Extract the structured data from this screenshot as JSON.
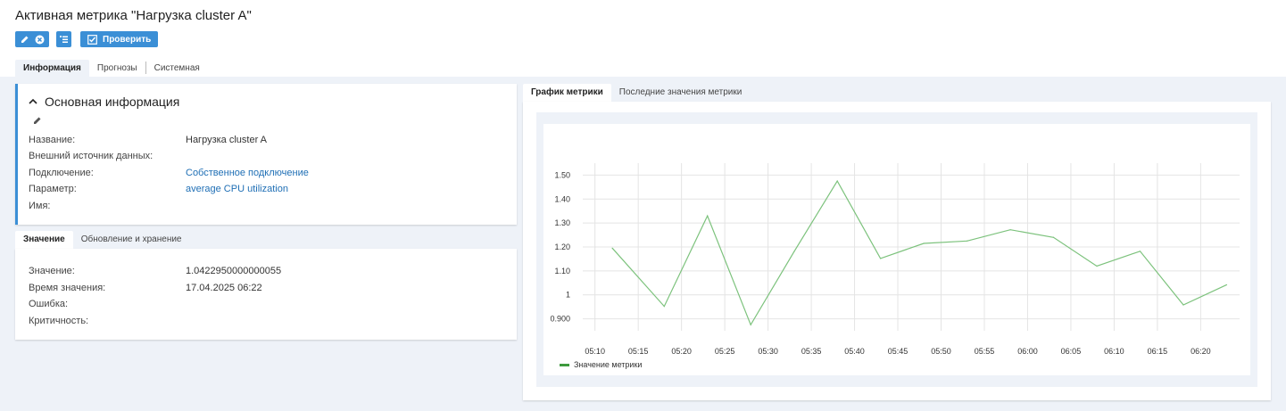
{
  "page": {
    "title": "Активная метрика \"Нагрузка cluster A\""
  },
  "toolbar": {
    "edit_icon": "pencil-icon",
    "delete_icon": "close-circle-icon",
    "add_icon": "add-list-icon",
    "check_label": "Проверить",
    "check_icon": "checkbox-icon"
  },
  "tabs_top": [
    {
      "label": "Информация",
      "active": true
    },
    {
      "label": "Прогнозы",
      "active": false
    },
    {
      "label": "Системная",
      "active": false
    }
  ],
  "basic_info": {
    "header": "Основная информация",
    "collapse_icon": "chevron-up-icon",
    "edit_icon": "pencil-icon",
    "fields": [
      {
        "label": "Название:",
        "value": "Нагрузка cluster A",
        "link": false
      },
      {
        "label": "Внешний источник данных:",
        "value": "",
        "link": false
      },
      {
        "label": "Подключение:",
        "value": "Собственное подключение",
        "link": true
      },
      {
        "label": "Параметр:",
        "value": "average CPU utilization",
        "link": true
      },
      {
        "label": "Имя:",
        "value": "",
        "link": false
      }
    ]
  },
  "tabs_mid": [
    {
      "label": "Значение",
      "active": true
    },
    {
      "label": "Обновление и хранение",
      "active": false
    }
  ],
  "value_info": {
    "fields": [
      {
        "label": "Значение:",
        "value": "1.0422950000000055"
      },
      {
        "label": "Время значения:",
        "value": "17.04.2025 06:22"
      },
      {
        "label": "Ошибка:",
        "value": ""
      },
      {
        "label": "Критичность:",
        "value": ""
      }
    ]
  },
  "chart_tabs": [
    {
      "label": "График метрики",
      "active": true
    },
    {
      "label": "Последние значения метрики",
      "active": false
    }
  ],
  "chart_data": {
    "type": "line",
    "x": [
      "05:12",
      "05:18",
      "05:23",
      "05:28",
      "05:33",
      "05:38",
      "05:43",
      "05:48",
      "05:53",
      "05:58",
      "06:03",
      "06:08",
      "06:13",
      "06:18",
      "06:23"
    ],
    "series": [
      {
        "name": "Значение метрики",
        "color": "#7cc27c",
        "values": [
          1.195,
          0.952,
          1.33,
          0.875,
          1.18,
          1.475,
          1.152,
          1.215,
          1.225,
          1.272,
          1.24,
          1.12,
          1.182,
          0.958,
          1.042
        ]
      }
    ],
    "x_ticks": [
      "05:10",
      "05:15",
      "05:20",
      "05:25",
      "05:30",
      "05:35",
      "05:40",
      "05:45",
      "05:50",
      "05:55",
      "06:00",
      "06:05",
      "06:10",
      "06:15",
      "06:20"
    ],
    "y_ticks": [
      "1.50",
      "1.40",
      "1.30",
      "1.20",
      "1.10",
      "1",
      "0.900"
    ],
    "y_tick_values": [
      1.5,
      1.4,
      1.3,
      1.2,
      1.1,
      1.0,
      0.9
    ],
    "ylim": [
      0.85,
      1.55
    ],
    "grid": true,
    "legend": "bottom-left"
  },
  "colors": {
    "accent": "#3b8fd6",
    "link": "#1f6fb5",
    "series": "#7cc27c",
    "background": "#eef2f8"
  }
}
